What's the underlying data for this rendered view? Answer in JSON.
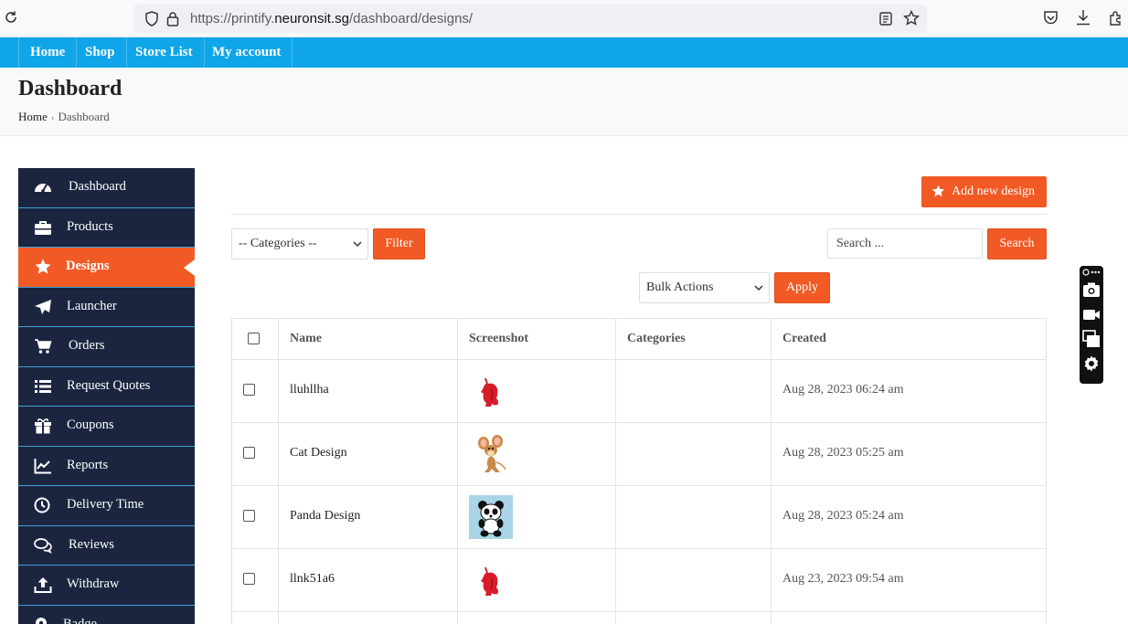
{
  "browser": {
    "url_prefix": "https://printify.",
    "url_host": "neuronsit.sg",
    "url_path": "/dashboard/designs/",
    "icons": [
      "reload-icon",
      "shield-icon",
      "lock-icon",
      "reader-view-icon",
      "bookmark-star-icon",
      "pocket-icon",
      "download-icon",
      "extensions-icon"
    ]
  },
  "top_nav": [
    "Home",
    "Shop",
    "Store List",
    "My account"
  ],
  "header": {
    "title": "Dashboard",
    "breadcrumb": [
      "Home",
      "Dashboard"
    ]
  },
  "sidebar": {
    "items": [
      {
        "label": "Dashboard",
        "icon": "dashboard-gauge-icon"
      },
      {
        "label": "Products",
        "icon": "briefcase-icon"
      },
      {
        "label": "Designs",
        "icon": "star-icon",
        "active": true
      },
      {
        "label": "Launcher",
        "icon": "paper-plane-icon"
      },
      {
        "label": "Orders",
        "icon": "cart-icon"
      },
      {
        "label": "Request Quotes",
        "icon": "list-icon"
      },
      {
        "label": "Coupons",
        "icon": "gift-icon"
      },
      {
        "label": "Reports",
        "icon": "chart-line-icon"
      },
      {
        "label": "Delivery Time",
        "icon": "clock-icon"
      },
      {
        "label": "Reviews",
        "icon": "comments-icon"
      },
      {
        "label": "Withdraw",
        "icon": "upload-icon"
      },
      {
        "label": "Badge",
        "icon": "map-marker-icon"
      }
    ]
  },
  "toolbar": {
    "add_new_label": "Add new design",
    "categories_selected": "-- Categories --",
    "filter_label": "Filter",
    "search_placeholder": "Search ...",
    "search_label": "Search",
    "bulk_selected": "Bulk Actions",
    "apply_label": "Apply"
  },
  "table": {
    "headers": [
      "Name",
      "Screenshot",
      "Categories",
      "Created"
    ],
    "rows": [
      {
        "name": "lluhllha",
        "screenshot": "red-cat-thumbnail",
        "categories": "",
        "created": "Aug 28, 2023 06:24 am"
      },
      {
        "name": "Cat Design",
        "screenshot": "cartoon-mouse-thumbnail",
        "categories": "",
        "created": "Aug 28, 2023 05:25 am"
      },
      {
        "name": "Panda Design",
        "screenshot": "panda-thumbnail",
        "categories": "",
        "created": "Aug 28, 2023 05:24 am"
      },
      {
        "name": "llnk51a6",
        "screenshot": "red-cat-thumbnail",
        "categories": "",
        "created": "Aug 23, 2023 09:54 am"
      }
    ]
  },
  "colors": {
    "nav_blue": "#0ea5e9",
    "accent_orange": "#f15a24",
    "sidebar_navy": "#1b2540"
  }
}
